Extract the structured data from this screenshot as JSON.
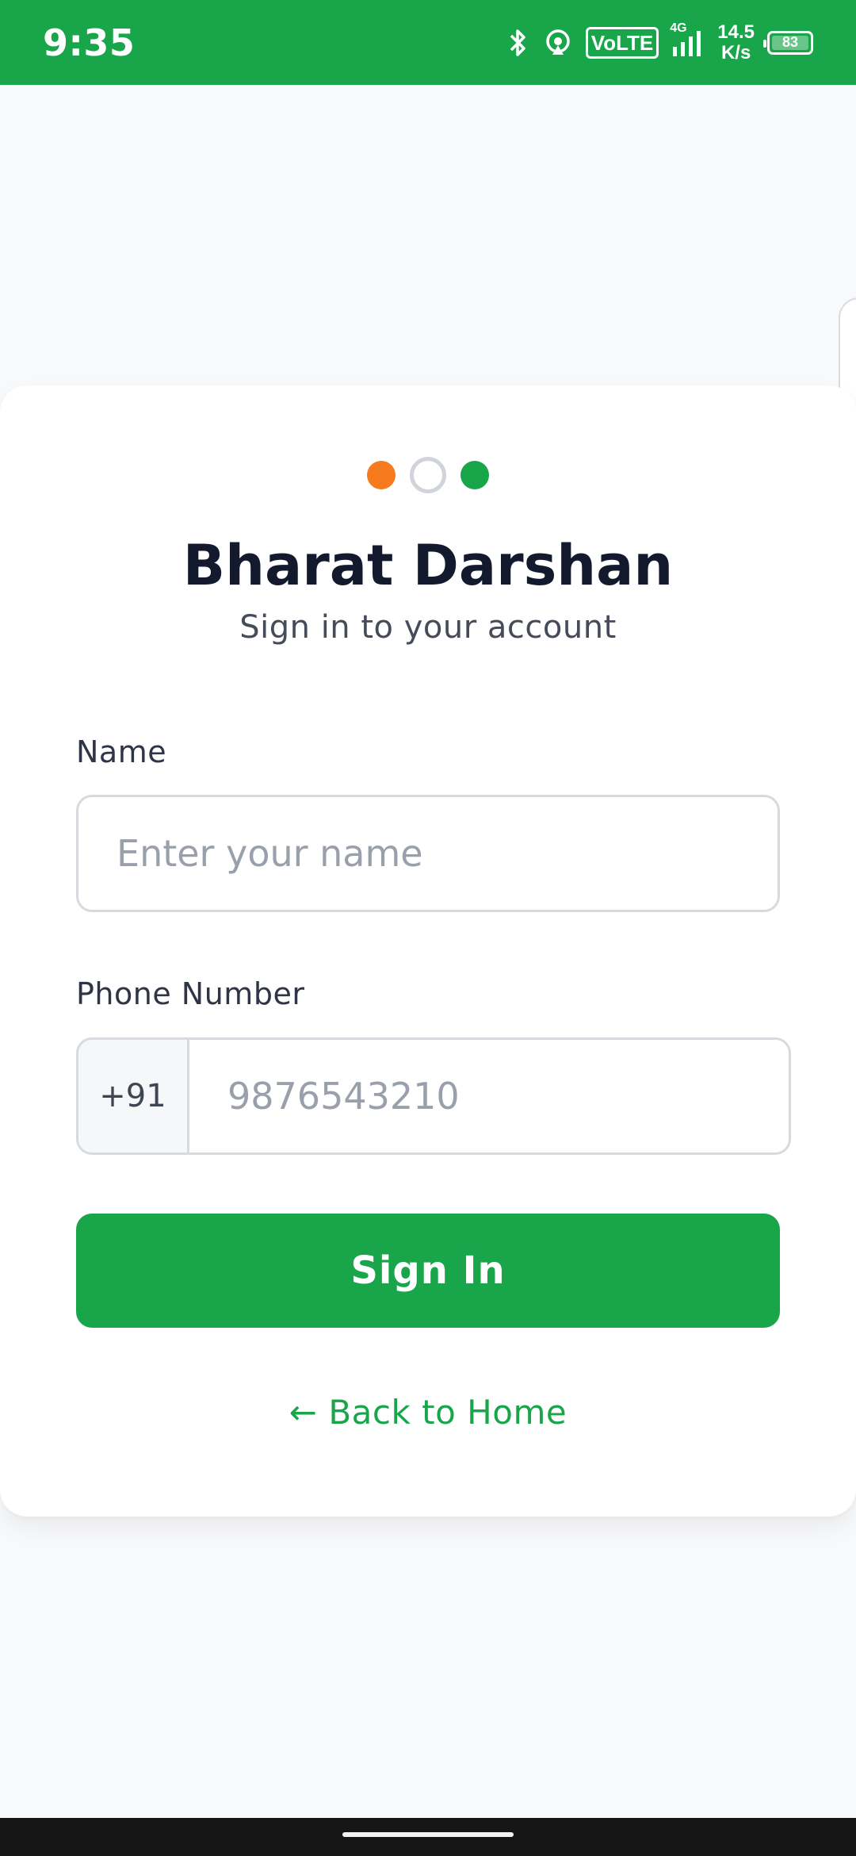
{
  "status_bar": {
    "time": "9:35",
    "network_badge": "VoLTE",
    "network_type": "4G",
    "speed_value": "14.5",
    "speed_unit": "K/s",
    "battery_level": "83",
    "icons": [
      "bluetooth-icon",
      "hotspot-icon",
      "signal-icon",
      "battery-icon"
    ],
    "background_color": "#19a54a"
  },
  "brand": {
    "dots_colors": [
      "#f77a1f",
      "#ffffff",
      "#19a54a"
    ],
    "title": "Bharat Darshan",
    "subtitle": "Sign in to your account"
  },
  "form": {
    "name_label": "Name",
    "name_placeholder": "Enter your name",
    "phone_label": "Phone Number",
    "country_code": "+91",
    "phone_placeholder": "9876543210",
    "submit_label": "Sign In",
    "back_link": "← Back to Home"
  },
  "theme": {
    "primary_green": "#19a54a",
    "saffron": "#f77a1f",
    "text_dark": "#141a2e"
  }
}
